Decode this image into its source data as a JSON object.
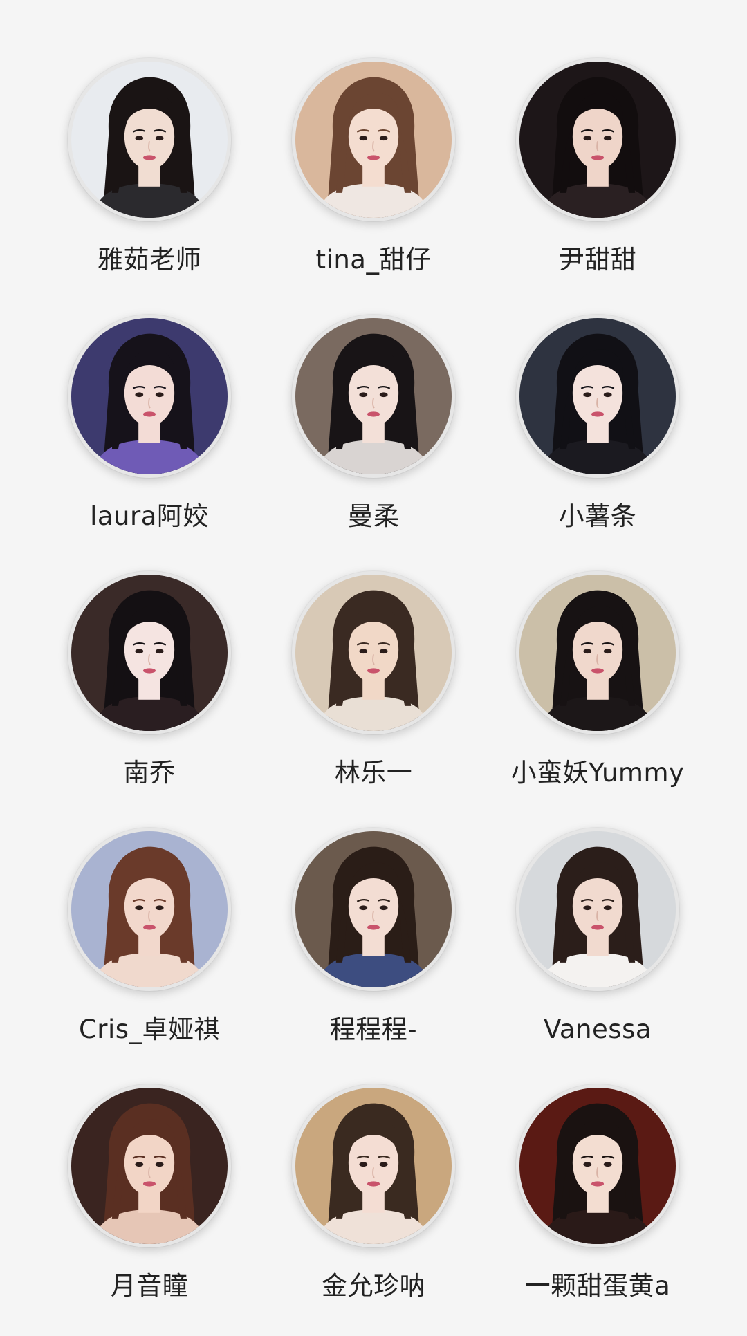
{
  "profiles": [
    {
      "name": "雅茹老师",
      "bg": "#e8ebef",
      "skin": "#f1ddd2",
      "hair": "#1a1414",
      "top": "#2b2a2e"
    },
    {
      "name": "tina_甜仔",
      "bg": "#d9b79c",
      "skin": "#f4ddd0",
      "hair": "#6b4532",
      "top": "#efe7e2"
    },
    {
      "name": "尹甜甜",
      "bg": "#1d1618",
      "skin": "#efd5c9",
      "hair": "#120d0e",
      "top": "#2a2022"
    },
    {
      "name": "laura阿姣",
      "bg": "#3d3a6e",
      "skin": "#f3dcd6",
      "hair": "#16121a",
      "top": "#6f5bb6"
    },
    {
      "name": "曼柔",
      "bg": "#7a6a60",
      "skin": "#f3e0d8",
      "hair": "#181416",
      "top": "#d9d4d2"
    },
    {
      "name": "小薯条",
      "bg": "#2e3340",
      "skin": "#f4e2dc",
      "hair": "#111015",
      "top": "#1b1a20"
    },
    {
      "name": "南乔",
      "bg": "#3a2a28",
      "skin": "#f5e4e1",
      "hair": "#141013",
      "top": "#2a1e21"
    },
    {
      "name": "林乐一",
      "bg": "#d8c9b6",
      "skin": "#f1d8c7",
      "hair": "#3a2a22",
      "top": "#e9dfd5"
    },
    {
      "name": "小蛮妖Yummy",
      "bg": "#cbbfa8",
      "skin": "#f0d8cc",
      "hair": "#171213",
      "top": "#1c1718"
    },
    {
      "name": "Cris_卓娅祺",
      "bg": "#a9b3d1",
      "skin": "#f2d8cc",
      "hair": "#6a3a2a",
      "top": "#f0d9cd"
    },
    {
      "name": "程程程-",
      "bg": "#6b5a4d",
      "skin": "#f3ddd3",
      "hair": "#2a1d17",
      "top": "#3d4d80"
    },
    {
      "name": "Vanessa",
      "bg": "#d6d9dc",
      "skin": "#f1dacf",
      "hair": "#2b1e1a",
      "top": "#f4f2f0"
    },
    {
      "name": "月音瞳",
      "bg": "#3a2420",
      "skin": "#f2d5c6",
      "hair": "#5a2f22",
      "top": "#e6c6b6"
    },
    {
      "name": "金允珍呐",
      "bg": "#c9a77e",
      "skin": "#f4ddd3",
      "hair": "#3a2a20",
      "top": "#efe1d8"
    },
    {
      "name": "一颗甜蛋黄a",
      "bg": "#5a1a14",
      "skin": "#f3ddd1",
      "hair": "#1a1211",
      "top": "#2a1a18"
    }
  ]
}
